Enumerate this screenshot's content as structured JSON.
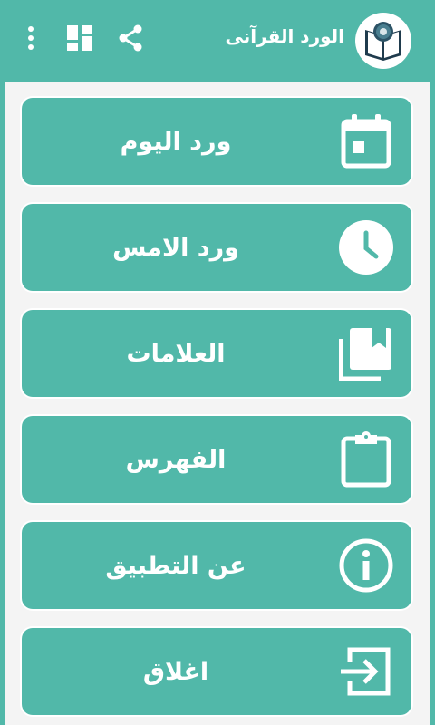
{
  "app_bar": {
    "title": "الورد القرآنى",
    "background": "#51b8a9",
    "actions": [
      "overflow-menu-icon",
      "dashboard-icon",
      "share-icon"
    ]
  },
  "menu": {
    "items": [
      {
        "label": "ورد اليوم",
        "icon": "calendar-icon"
      },
      {
        "label": "ورد الامس",
        "icon": "clock-icon"
      },
      {
        "label": "العلامات",
        "icon": "bookmarks-icon"
      },
      {
        "label": "الفهرس",
        "icon": "clipboard-icon"
      },
      {
        "label": "عن التطبيق",
        "icon": "info-icon"
      },
      {
        "label": "اغلاق",
        "icon": "exit-icon"
      }
    ]
  },
  "colors": {
    "accent": "#51b8a9",
    "panel": "#f4f4f4",
    "text": "#ffffff"
  }
}
